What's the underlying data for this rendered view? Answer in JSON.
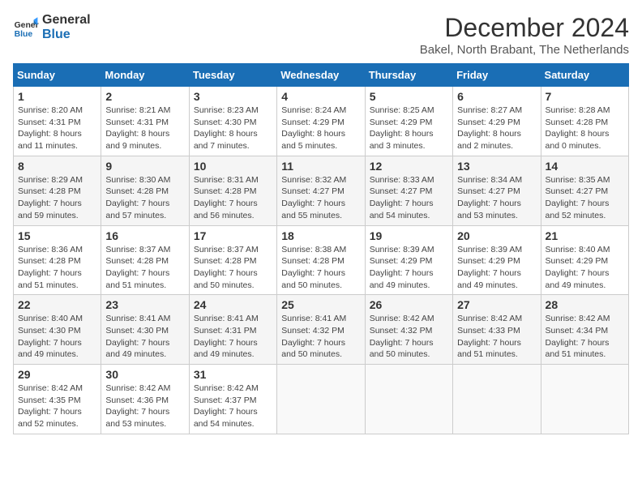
{
  "header": {
    "logo_line1": "General",
    "logo_line2": "Blue",
    "title": "December 2024",
    "subtitle": "Bakel, North Brabant, The Netherlands"
  },
  "days_of_week": [
    "Sunday",
    "Monday",
    "Tuesday",
    "Wednesday",
    "Thursday",
    "Friday",
    "Saturday"
  ],
  "weeks": [
    [
      {
        "day": "1",
        "sunrise": "8:20 AM",
        "sunset": "4:31 PM",
        "daylight": "8 hours and 11 minutes."
      },
      {
        "day": "2",
        "sunrise": "8:21 AM",
        "sunset": "4:31 PM",
        "daylight": "8 hours and 9 minutes."
      },
      {
        "day": "3",
        "sunrise": "8:23 AM",
        "sunset": "4:30 PM",
        "daylight": "8 hours and 7 minutes."
      },
      {
        "day": "4",
        "sunrise": "8:24 AM",
        "sunset": "4:29 PM",
        "daylight": "8 hours and 5 minutes."
      },
      {
        "day": "5",
        "sunrise": "8:25 AM",
        "sunset": "4:29 PM",
        "daylight": "8 hours and 3 minutes."
      },
      {
        "day": "6",
        "sunrise": "8:27 AM",
        "sunset": "4:29 PM",
        "daylight": "8 hours and 2 minutes."
      },
      {
        "day": "7",
        "sunrise": "8:28 AM",
        "sunset": "4:28 PM",
        "daylight": "8 hours and 0 minutes."
      }
    ],
    [
      {
        "day": "8",
        "sunrise": "8:29 AM",
        "sunset": "4:28 PM",
        "daylight": "7 hours and 59 minutes."
      },
      {
        "day": "9",
        "sunrise": "8:30 AM",
        "sunset": "4:28 PM",
        "daylight": "7 hours and 57 minutes."
      },
      {
        "day": "10",
        "sunrise": "8:31 AM",
        "sunset": "4:28 PM",
        "daylight": "7 hours and 56 minutes."
      },
      {
        "day": "11",
        "sunrise": "8:32 AM",
        "sunset": "4:27 PM",
        "daylight": "7 hours and 55 minutes."
      },
      {
        "day": "12",
        "sunrise": "8:33 AM",
        "sunset": "4:27 PM",
        "daylight": "7 hours and 54 minutes."
      },
      {
        "day": "13",
        "sunrise": "8:34 AM",
        "sunset": "4:27 PM",
        "daylight": "7 hours and 53 minutes."
      },
      {
        "day": "14",
        "sunrise": "8:35 AM",
        "sunset": "4:27 PM",
        "daylight": "7 hours and 52 minutes."
      }
    ],
    [
      {
        "day": "15",
        "sunrise": "8:36 AM",
        "sunset": "4:28 PM",
        "daylight": "7 hours and 51 minutes."
      },
      {
        "day": "16",
        "sunrise": "8:37 AM",
        "sunset": "4:28 PM",
        "daylight": "7 hours and 51 minutes."
      },
      {
        "day": "17",
        "sunrise": "8:37 AM",
        "sunset": "4:28 PM",
        "daylight": "7 hours and 50 minutes."
      },
      {
        "day": "18",
        "sunrise": "8:38 AM",
        "sunset": "4:28 PM",
        "daylight": "7 hours and 50 minutes."
      },
      {
        "day": "19",
        "sunrise": "8:39 AM",
        "sunset": "4:29 PM",
        "daylight": "7 hours and 49 minutes."
      },
      {
        "day": "20",
        "sunrise": "8:39 AM",
        "sunset": "4:29 PM",
        "daylight": "7 hours and 49 minutes."
      },
      {
        "day": "21",
        "sunrise": "8:40 AM",
        "sunset": "4:29 PM",
        "daylight": "7 hours and 49 minutes."
      }
    ],
    [
      {
        "day": "22",
        "sunrise": "8:40 AM",
        "sunset": "4:30 PM",
        "daylight": "7 hours and 49 minutes."
      },
      {
        "day": "23",
        "sunrise": "8:41 AM",
        "sunset": "4:30 PM",
        "daylight": "7 hours and 49 minutes."
      },
      {
        "day": "24",
        "sunrise": "8:41 AM",
        "sunset": "4:31 PM",
        "daylight": "7 hours and 49 minutes."
      },
      {
        "day": "25",
        "sunrise": "8:41 AM",
        "sunset": "4:32 PM",
        "daylight": "7 hours and 50 minutes."
      },
      {
        "day": "26",
        "sunrise": "8:42 AM",
        "sunset": "4:32 PM",
        "daylight": "7 hours and 50 minutes."
      },
      {
        "day": "27",
        "sunrise": "8:42 AM",
        "sunset": "4:33 PM",
        "daylight": "7 hours and 51 minutes."
      },
      {
        "day": "28",
        "sunrise": "8:42 AM",
        "sunset": "4:34 PM",
        "daylight": "7 hours and 51 minutes."
      }
    ],
    [
      {
        "day": "29",
        "sunrise": "8:42 AM",
        "sunset": "4:35 PM",
        "daylight": "7 hours and 52 minutes."
      },
      {
        "day": "30",
        "sunrise": "8:42 AM",
        "sunset": "4:36 PM",
        "daylight": "7 hours and 53 minutes."
      },
      {
        "day": "31",
        "sunrise": "8:42 AM",
        "sunset": "4:37 PM",
        "daylight": "7 hours and 54 minutes."
      },
      null,
      null,
      null,
      null
    ]
  ]
}
